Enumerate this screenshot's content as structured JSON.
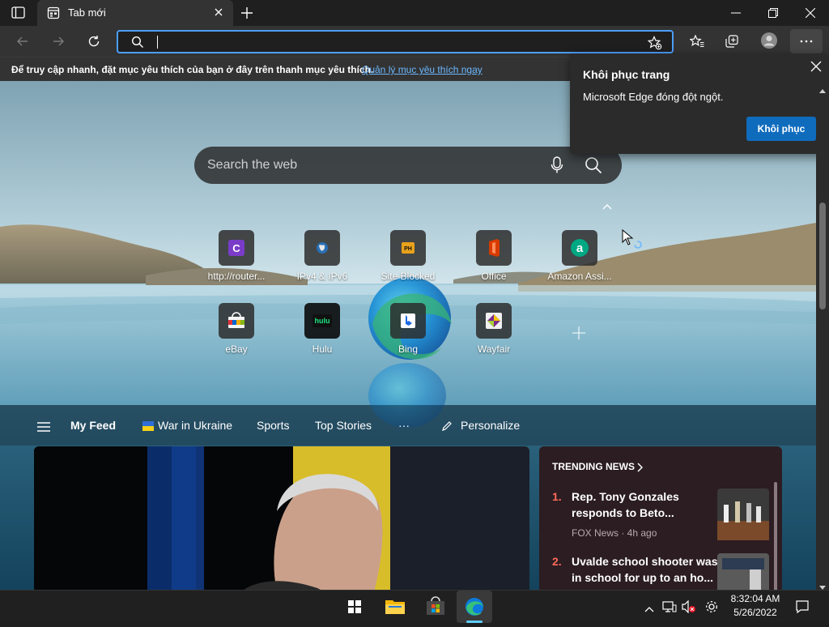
{
  "tab": {
    "title": "Tab mới"
  },
  "address": {
    "value": ""
  },
  "favbar": {
    "message": "Để truy cập nhanh, đặt mục yêu thích của bạn ở đây trên thanh mục yêu thích.",
    "link": "Quản lý mục yêu thích ngay"
  },
  "search": {
    "placeholder": "Search the web"
  },
  "quicklinks": [
    {
      "label": "http://router...",
      "icon": "router-c-icon",
      "color": "#7a3cc8"
    },
    {
      "label": "IPv4 & IPv6",
      "icon": "globe-icon",
      "color": "#2a6fb3"
    },
    {
      "label": "Site Blocked",
      "icon": "ph-icon",
      "color": "#e8a21a"
    },
    {
      "label": "Office",
      "icon": "office-icon",
      "color": "#d83b01"
    },
    {
      "label": "Amazon Assi...",
      "icon": "amazon-a-icon",
      "color": "#00a884"
    },
    {
      "label": "eBay",
      "icon": "ebay-bag-icon",
      "color": "#2b2b2b"
    },
    {
      "label": "Hulu",
      "icon": "hulu-icon",
      "color": "#1ce783"
    },
    {
      "label": "Bing",
      "icon": "bing-icon",
      "color": "#1b6ae0"
    },
    {
      "label": "Wayfair",
      "icon": "wayfair-icon",
      "color": "#7b2a8c"
    }
  ],
  "feednav": {
    "my_feed": "My Feed",
    "ukraine": "War in Ukraine",
    "sports": "Sports",
    "top_stories": "Top Stories",
    "more": "···",
    "personalize": "Personalize"
  },
  "trending": {
    "header": "TRENDING NEWS",
    "items": [
      {
        "rank": "1.",
        "title_line1": "Rep. Tony Gonzales",
        "title_line2": "responds to Beto...",
        "source": "FOX News · 4h ago"
      },
      {
        "rank": "2.",
        "title_line1": "Uvalde school shooter was",
        "title_line2": "in school for up to an ho..."
      }
    ]
  },
  "restore": {
    "title": "Khôi phục trang",
    "message": "Microsoft Edge đóng đột ngột.",
    "button": "Khôi phục"
  },
  "clock": {
    "time": "8:32:04 AM",
    "date": "5/26/2022"
  },
  "colors": {
    "accent": "#4b9ffd",
    "restore_button": "#0f6cbd",
    "trending_rank": "#ff6a5a"
  }
}
